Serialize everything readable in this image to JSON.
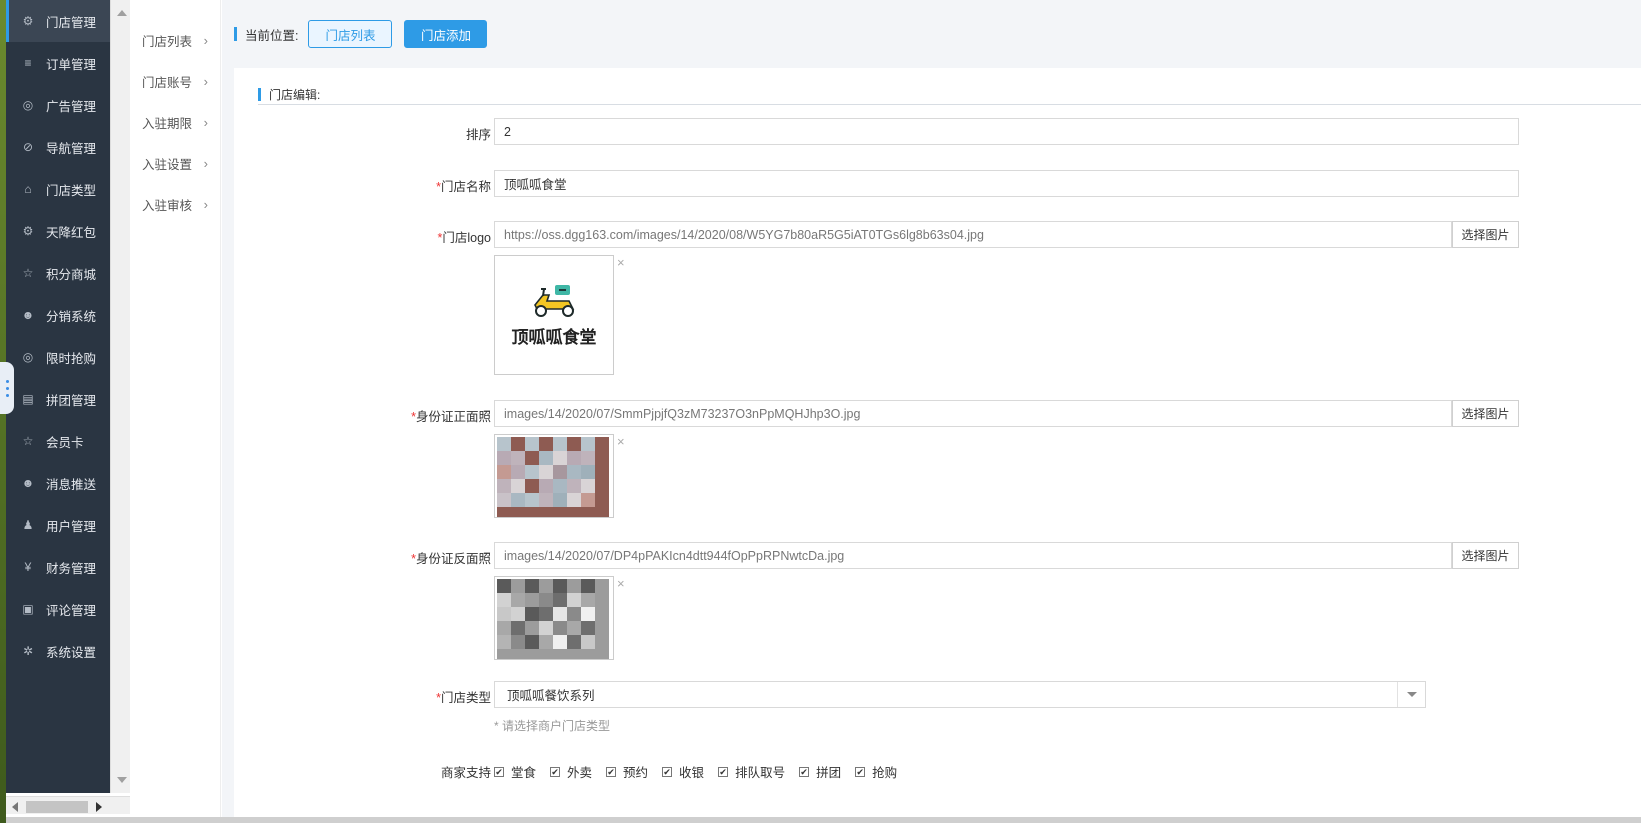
{
  "sidebar": {
    "items": [
      {
        "label": "门店管理",
        "icon": "cubes-icon",
        "glyph": "⚙",
        "active": true
      },
      {
        "label": "订单管理",
        "icon": "list-icon",
        "glyph": "≡"
      },
      {
        "label": "广告管理",
        "icon": "lifebuoy-icon",
        "glyph": "◎"
      },
      {
        "label": "导航管理",
        "icon": "compass-icon",
        "glyph": "⊘"
      },
      {
        "label": "门店类型",
        "icon": "bank-icon",
        "glyph": "⌂"
      },
      {
        "label": "天降红包",
        "icon": "cubes-icon",
        "glyph": "⚙"
      },
      {
        "label": "积分商城",
        "icon": "star-icon",
        "glyph": "☆"
      },
      {
        "label": "分销系统",
        "icon": "users-icon",
        "glyph": "☻"
      },
      {
        "label": "限时抢购",
        "icon": "lifebuoy-icon",
        "glyph": "◎"
      },
      {
        "label": "拼团管理",
        "icon": "id-card-icon",
        "glyph": "▤"
      },
      {
        "label": "会员卡",
        "icon": "star-icon",
        "glyph": "☆"
      },
      {
        "label": "消息推送",
        "icon": "users-icon",
        "glyph": "☻"
      },
      {
        "label": "用户管理",
        "icon": "user-icon",
        "glyph": "♟"
      },
      {
        "label": "财务管理",
        "icon": "yen-icon",
        "glyph": "¥"
      },
      {
        "label": "评论管理",
        "icon": "money-icon",
        "glyph": "▣"
      },
      {
        "label": "系统设置",
        "icon": "gear-icon",
        "glyph": "✲"
      }
    ]
  },
  "submenu": {
    "items": [
      {
        "label": "门店列表"
      },
      {
        "label": "门店账号"
      },
      {
        "label": "入驻期限"
      },
      {
        "label": "入驻设置"
      },
      {
        "label": "入驻审核"
      }
    ],
    "chevron": "›"
  },
  "topbar": {
    "position_label": "当前位置:",
    "store_list_button": "门店列表",
    "store_add_button": "门店添加"
  },
  "form": {
    "section_title": "门店编辑:",
    "sort": {
      "label": "排序",
      "value": "2"
    },
    "store_name": {
      "required": "*",
      "label": "门店名称",
      "value": "顶呱呱食堂"
    },
    "store_logo": {
      "required": "*",
      "label": "门店logo",
      "value": "https://oss.dgg163.com/images/14/2020/08/W5YG7b80aR5G5iAT0TGs6lg8b63s04.jpg",
      "button": "选择图片",
      "preview_text": "顶呱呱食堂"
    },
    "id_front": {
      "required": "*",
      "label": "身份证正面照",
      "value": "images/14/2020/07/SmmPjpjfQ3zM73237O3nPpMQHJhp3O.jpg",
      "button": "选择图片"
    },
    "id_back": {
      "required": "*",
      "label": "身份证反面照",
      "value": "images/14/2020/07/DP4pPAKIcn4dtt944fOpPpRPNwtcDa.jpg",
      "button": "选择图片"
    },
    "store_type": {
      "required": "*",
      "label": "门店类型",
      "value": "顶呱呱餐饮系列",
      "hint": "* 请选择商户门店类型"
    },
    "merchant_support": {
      "label": "商家支持",
      "options": [
        {
          "label": "堂食",
          "checked": true
        },
        {
          "label": "外卖",
          "checked": true
        },
        {
          "label": "预约",
          "checked": true
        },
        {
          "label": "收银",
          "checked": true
        },
        {
          "label": "排队取号",
          "checked": true
        },
        {
          "label": "拼团",
          "checked": true
        },
        {
          "label": "抢购",
          "checked": true
        }
      ]
    },
    "close_glyph": "×",
    "check_glyph": "✔"
  },
  "colors": {
    "accent": "#2e9be6",
    "sidebar_bg": "#2a3542",
    "required": "#e33333"
  }
}
